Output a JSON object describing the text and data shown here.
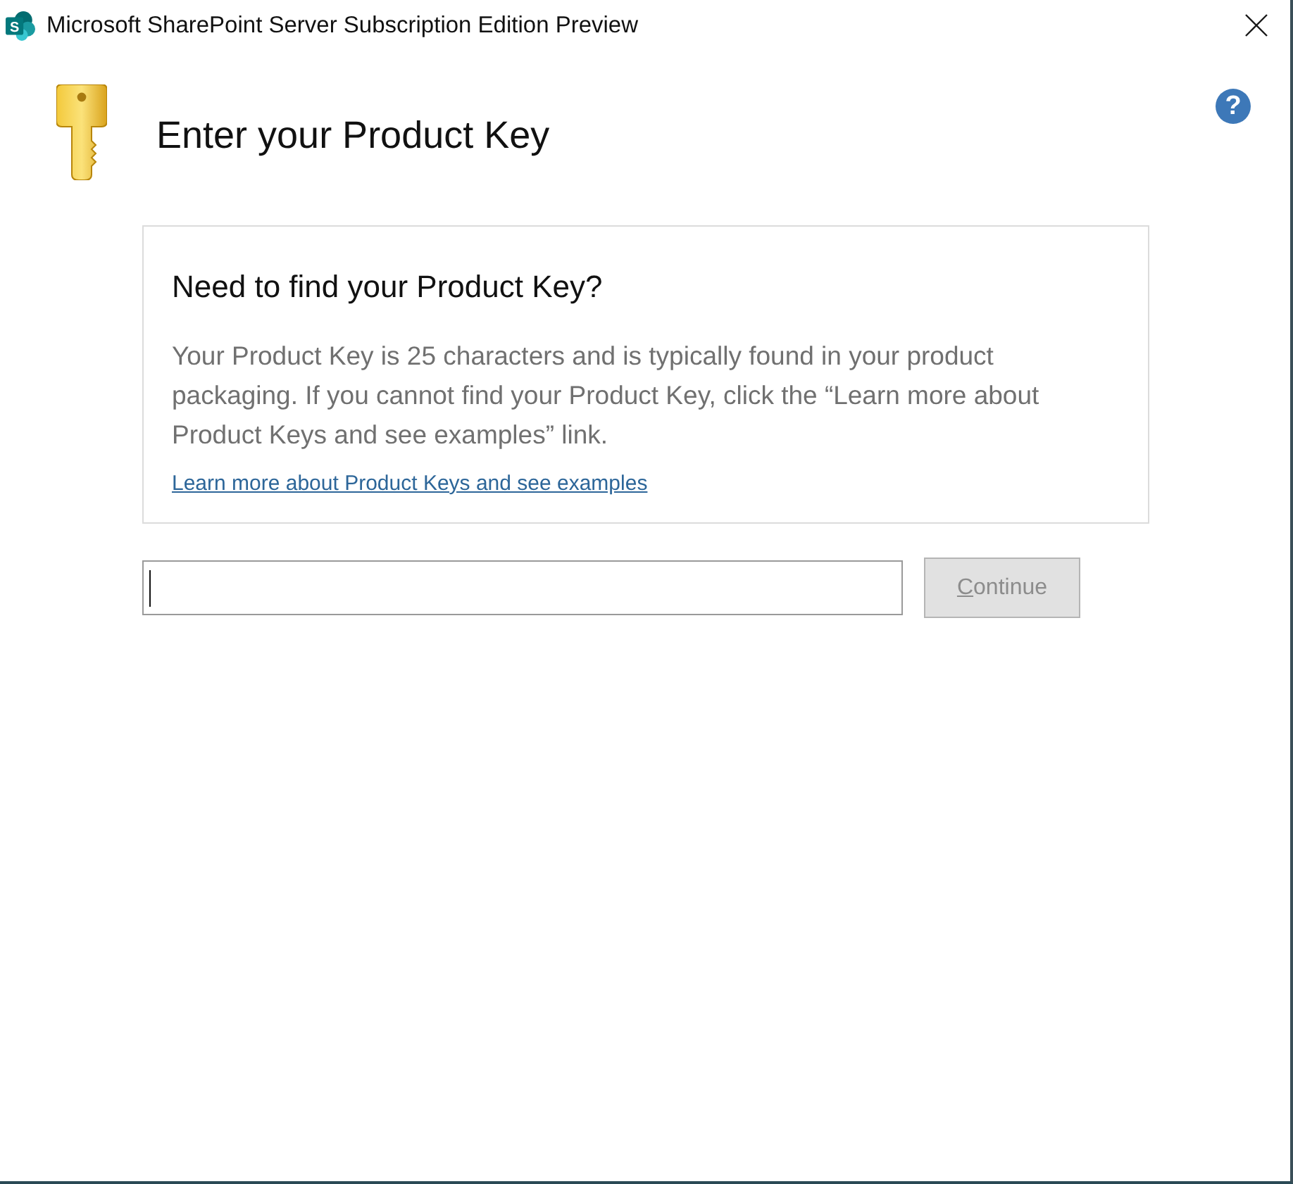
{
  "window": {
    "title": "Microsoft SharePoint Server Subscription Edition Preview",
    "logo_letter": "S"
  },
  "help_button": {
    "label": "?"
  },
  "heading": "Enter your Product Key",
  "info_card": {
    "heading": "Need to find your Product Key?",
    "text": "Your Product Key is 25 characters and is typically found in your product packaging. If you cannot find your Product Key, click the “Learn more about Product Keys and see examples” link.",
    "link": "Learn more about Product Keys and see examples"
  },
  "key_field": {
    "focused": true
  },
  "continue_button": {
    "label": "Continue",
    "disabled": true
  }
}
